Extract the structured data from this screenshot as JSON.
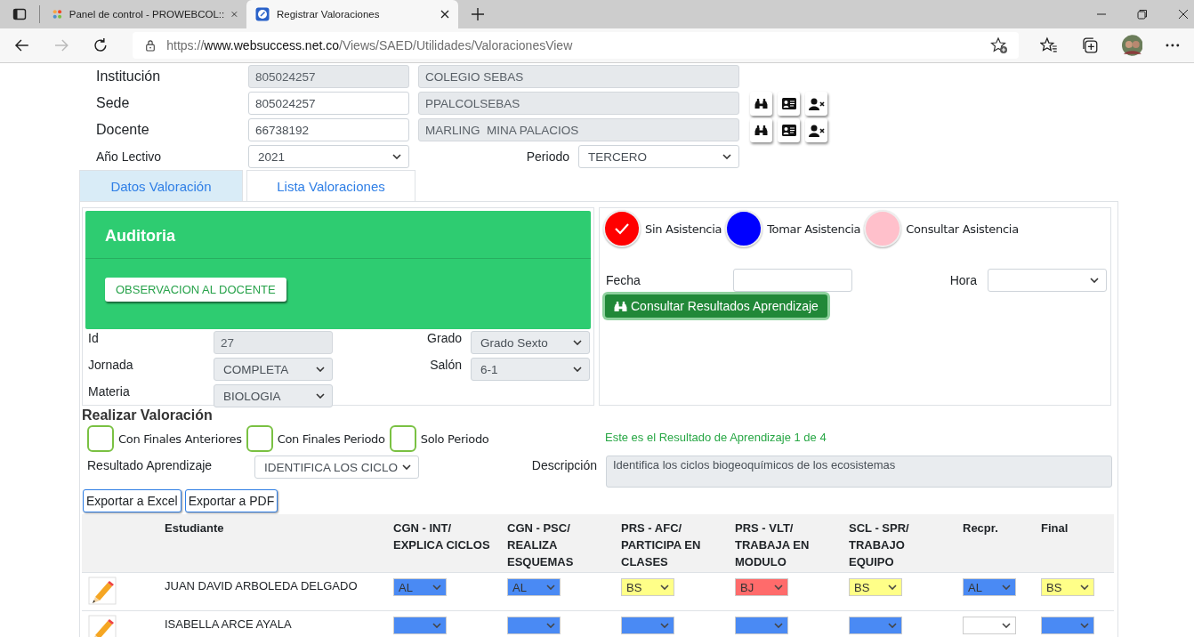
{
  "browser": {
    "tabs": [
      {
        "title": "Panel de control - PROWEBCOL::",
        "selected": false
      },
      {
        "title": "Registrar Valoraciones",
        "selected": true
      }
    ],
    "url": {
      "scheme": "https://",
      "host": "www.websuccess.net.co",
      "path": "/Views/SAED/Utilidades/ValoracionesView"
    }
  },
  "header_fields": [
    {
      "label": "Institución",
      "code": "805024257",
      "code_readonly": true,
      "name": "COLEGIO SEBAS",
      "actions": false
    },
    {
      "label": "Sede",
      "code": "805024257",
      "code_readonly": false,
      "name": "PPALCOLSEBAS",
      "actions": true
    },
    {
      "label": "Docente",
      "code": "66738192",
      "code_readonly": false,
      "name": "MARLING  MINA PALACIOS",
      "actions": true
    }
  ],
  "year": {
    "label": "Año Lectivo",
    "value": "2021"
  },
  "period": {
    "label": "Periodo",
    "value": "TERCERO"
  },
  "tabs": [
    {
      "label": "Datos Valoración",
      "selected": true
    },
    {
      "label": "Lista Valoraciones",
      "selected": false
    }
  ],
  "audit": {
    "title": "Auditoria",
    "button": "OBSERVACION AL DOCENTE"
  },
  "left_fields": [
    {
      "label": "Id",
      "value": "27",
      "kind": "input"
    },
    {
      "label": "Jornada",
      "value": "COMPLETA",
      "kind": "select"
    },
    {
      "label": "Materia",
      "value": "BIOLOGIA",
      "kind": "select"
    }
  ],
  "right_fields": [
    {
      "label": "Grado",
      "value": "Grado Sexto",
      "kind": "select"
    },
    {
      "label": "Salón",
      "value": "6-1",
      "kind": "select"
    }
  ],
  "attendance": [
    {
      "label": "Sin Asistencia",
      "color": "#ff0000",
      "checked": true
    },
    {
      "label": "Tomar Asistencia",
      "color": "#0000ff",
      "checked": false
    },
    {
      "label": "Consultar Asistencia",
      "color": "#ffc0cb",
      "checked": false
    }
  ],
  "fecha": {
    "label": "Fecha"
  },
  "hora": {
    "label": "Hora"
  },
  "consult_button": "Consultar Resultados Aprendizaje",
  "valoracion": {
    "title": "Realizar Valoración",
    "options": [
      {
        "label": "Con Finales Anteriores",
        "checked": false
      },
      {
        "label": "Con Finales Periodo",
        "checked": false
      },
      {
        "label": "Solo Periodo",
        "checked": false
      }
    ],
    "result_label": "Resultado Aprendizaje",
    "result_value": "IDENTIFICA LOS CICLO",
    "status": "Este es el Resultado de Aprendizaje 1 de 4",
    "description_label": "Descripción",
    "description": "Identifica los ciclos biogeoquímicos de los ecosistemas"
  },
  "export_buttons": [
    "Exportar a Excel",
    "Exportar a PDF"
  ],
  "table": {
    "columns": [
      "Estudiante",
      "CGN - INT/ EXPLICA CICLOS",
      "CGN - PSC/ REALIZA ESQUEMAS",
      "PRS - AFC/ PARTICIPA EN CLASES",
      "PRS - VLT/ TRABAJA EN MODULO",
      "SCL - SPR/ TRABAJO EQUIPO",
      "Recpr.",
      "Final"
    ],
    "rows": [
      {
        "student": "JUAN DAVID ARBOLEDA DELGADO",
        "grades": [
          {
            "value": "AL",
            "color": "#4a8af4"
          },
          {
            "value": "AL",
            "color": "#4a8af4"
          },
          {
            "value": "BS",
            "color": "#ffff88"
          },
          {
            "value": "BJ",
            "color": "#ff6b6b"
          },
          {
            "value": "BS",
            "color": "#ffff88"
          },
          {
            "value": "AL",
            "color": "#4a8af4"
          },
          {
            "value": "BS",
            "color": "#ffff88"
          }
        ]
      },
      {
        "student": "ISABELLA ARCE AYALA",
        "grades": [
          {
            "color": "#4a8af4"
          },
          {
            "color": "#4a8af4"
          },
          {
            "color": "#4a8af4"
          },
          {
            "color": "#4a8af4"
          },
          {
            "color": "#4a8af4"
          },
          {
            "color": "#ffffff"
          },
          {
            "color": "#4a8af4"
          }
        ]
      }
    ]
  }
}
